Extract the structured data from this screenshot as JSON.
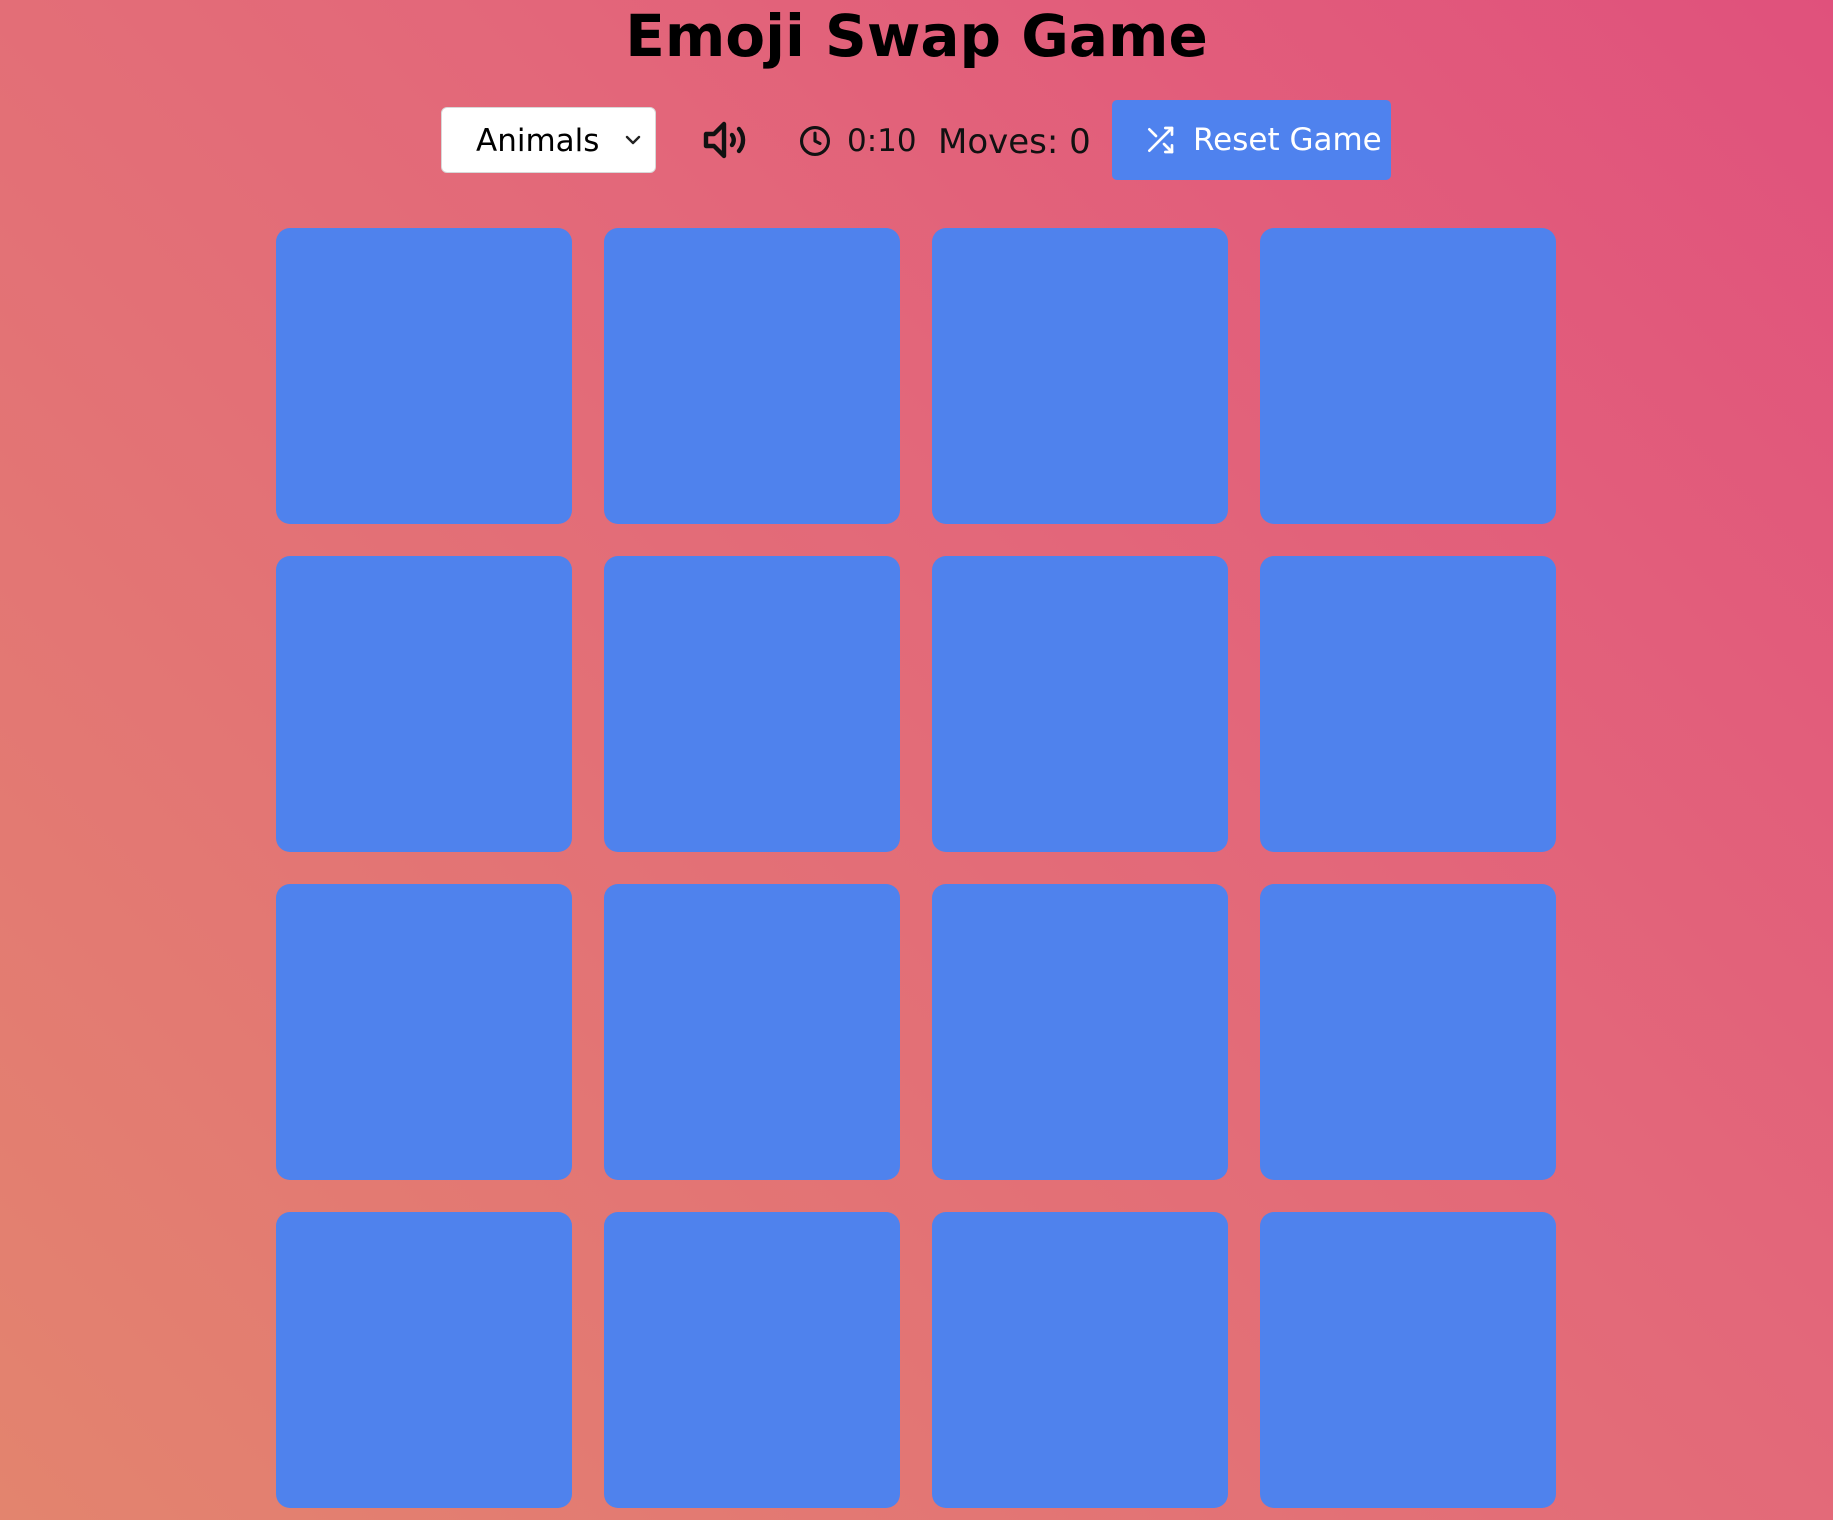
{
  "title": "Emoji Swap Game",
  "controls": {
    "category": {
      "selected": "Animals",
      "icon": "chevron-down-icon"
    },
    "sound": {
      "icon": "speaker-volume-icon"
    },
    "timer": {
      "icon": "clock-icon",
      "value": "0:10"
    },
    "moves": "Moves: 0",
    "reset": {
      "icon": "shuffle-icon",
      "label": "Reset Game"
    }
  },
  "board": {
    "rows": 4,
    "columns": 4,
    "tile_color": "#4f82ed",
    "tiles_face_down": 16
  },
  "colors": {
    "background_start": "#e3846e",
    "background_end": "#e0517c",
    "accent": "#4f82ee"
  }
}
